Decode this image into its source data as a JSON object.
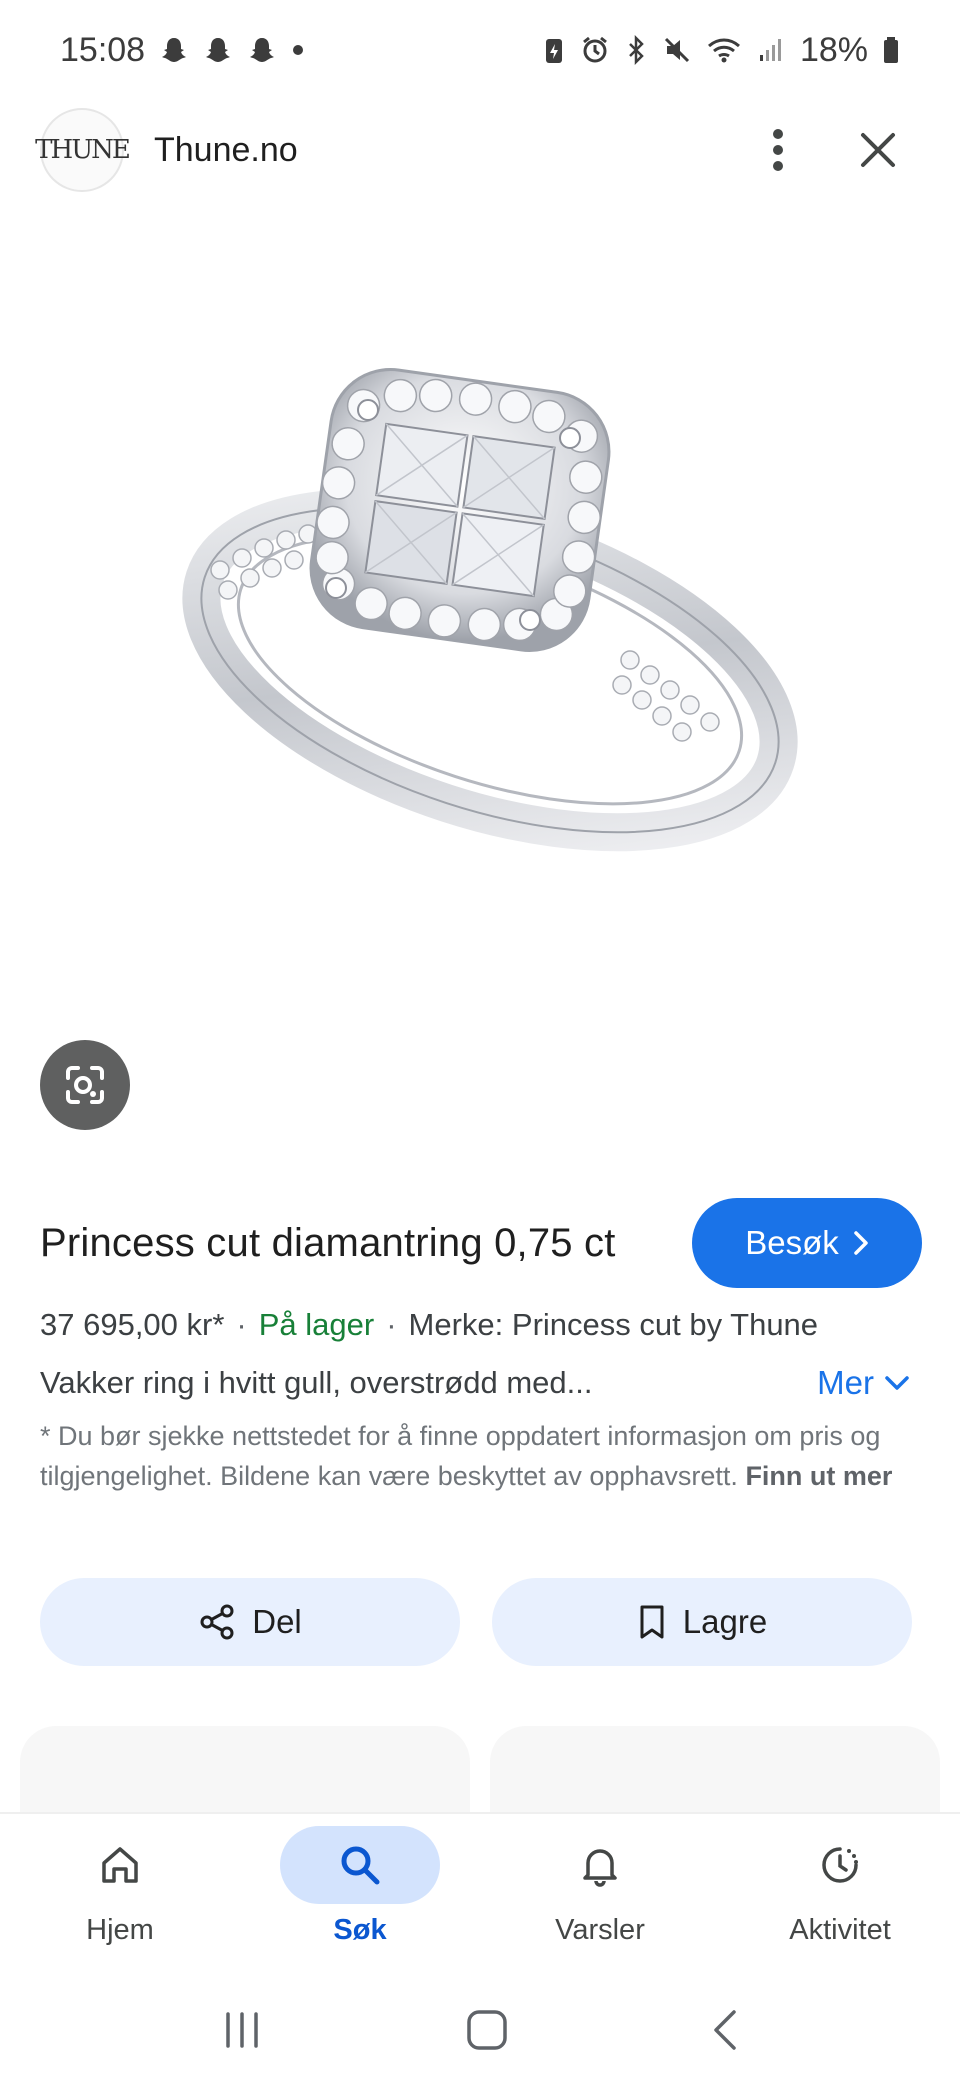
{
  "status": {
    "time": "15:08",
    "battery": "18%"
  },
  "header": {
    "logo_text": "THUNE",
    "site": "Thune.no"
  },
  "product": {
    "title": "Princess cut diamantring 0,75 ct",
    "visit_label": "Besøk",
    "price": "37 695,00 kr*",
    "stock": "På lager",
    "brand": "Merke: Princess cut by Thune",
    "description": "Vakker ring i hvitt gull, overstrødd med...",
    "more_label": "Mer",
    "disclaimer": "* Du bør sjekke nettstedet for å finne oppdatert informasjon om pris og tilgjengelighet. Bildene kan være beskyttet av opphavsrett.",
    "learn_more": "Finn ut mer"
  },
  "actions": {
    "share_label": "Del",
    "save_label": "Lagre"
  },
  "nav": {
    "home": "Hjem",
    "search": "Søk",
    "notifications": "Varsler",
    "activity": "Aktivitet"
  },
  "colors": {
    "accent": "#1a73e8",
    "in_stock": "#188038",
    "chip_bg": "#e8f0fe",
    "nav_active_bg": "#d3e3fd"
  }
}
